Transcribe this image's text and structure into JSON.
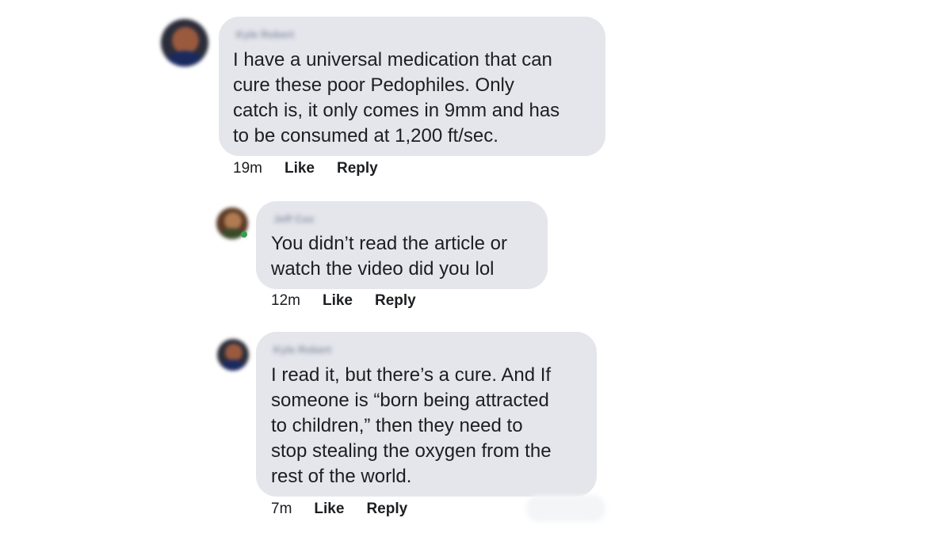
{
  "thread": {
    "comments": [
      {
        "author": "Kyle Robert",
        "lines": [
          "I have a universal medication that can",
          "cure these poor Pedophiles. Only",
          "catch is, it only comes in 9mm and has",
          "to be consumed at 1,200 ft/sec."
        ],
        "time": "19m",
        "like_label": "Like",
        "reply_label": "Reply"
      },
      {
        "author": "Jeff Cox",
        "lines": [
          "You didn’t read the article or",
          "watch the video did you lol"
        ],
        "time": "12m",
        "like_label": "Like",
        "reply_label": "Reply"
      },
      {
        "author": "Kyle Robert",
        "lines": [
          "I read it, but there’s a cure. And If",
          "someone is “born being attracted",
          "to children,” then they need to",
          "stop stealing the oxygen from the",
          "rest of the world."
        ],
        "time": "7m",
        "like_label": "Like",
        "reply_label": "Reply"
      }
    ]
  },
  "colors": {
    "bubble": "#e4e6eb",
    "text": "#1c1e21",
    "online": "#31a24c"
  }
}
